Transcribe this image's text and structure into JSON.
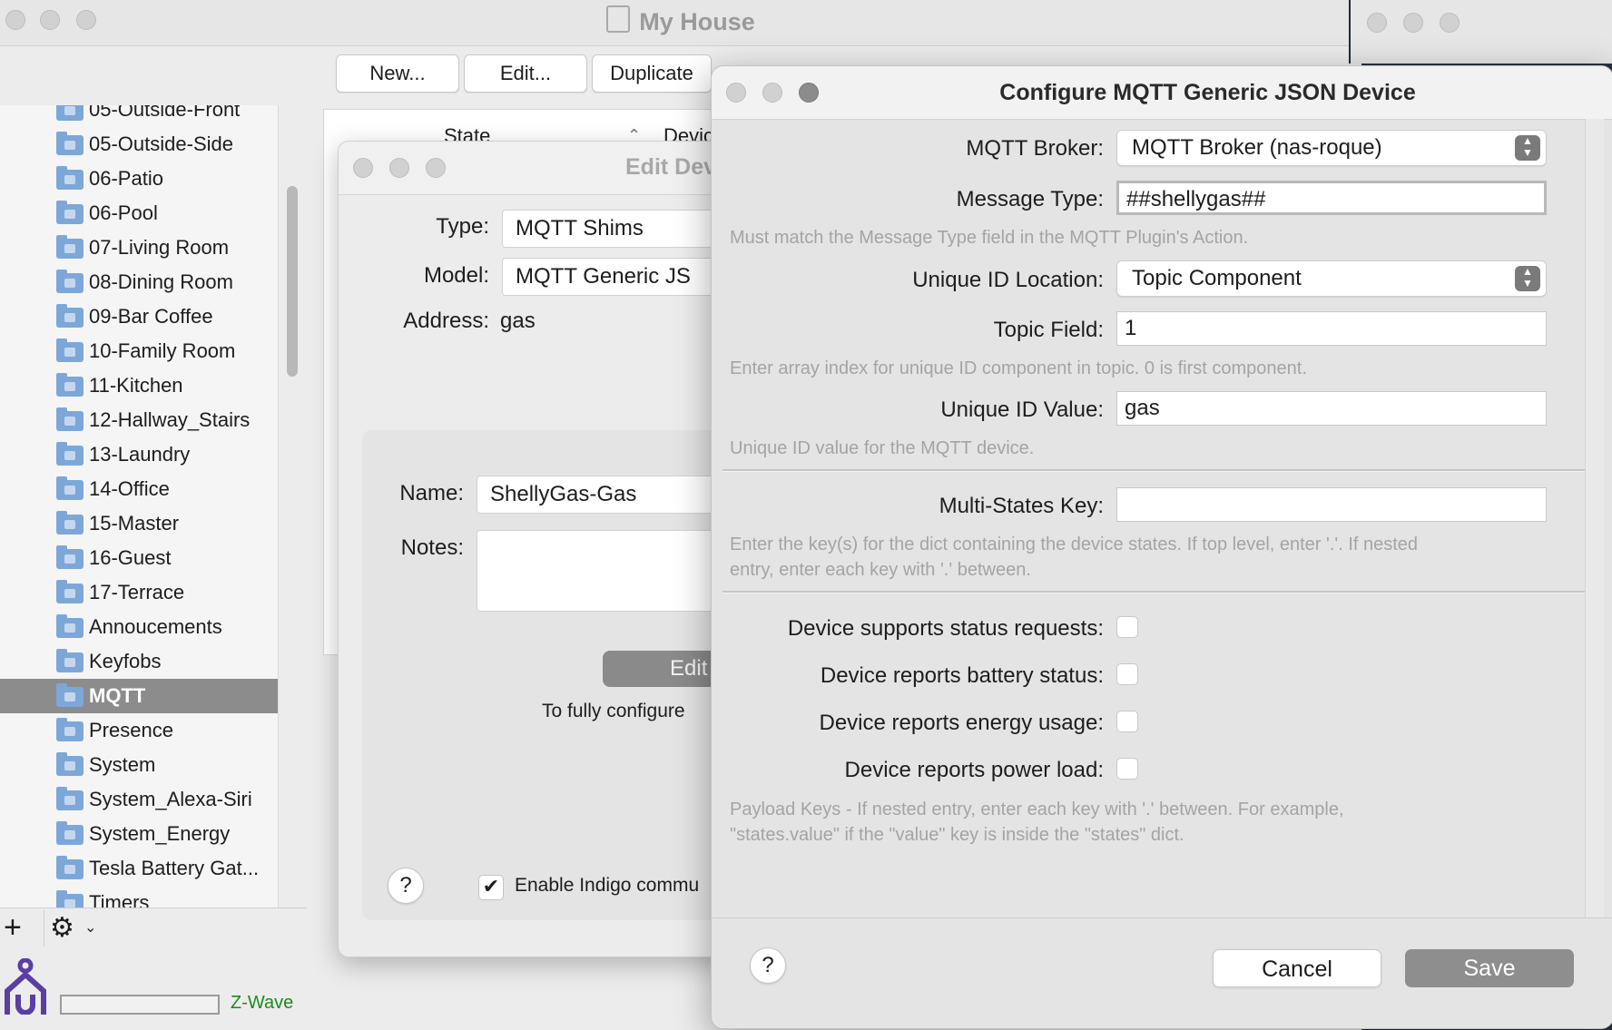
{
  "main": {
    "title": "My House",
    "toolbar": {
      "new_label": "New...",
      "edit_label": "Edit...",
      "duplicate_label": "Duplicate"
    },
    "list_header": {
      "state": "State",
      "device": "Devic"
    },
    "sidebar_items": [
      "05-Outside-Front",
      "05-Outside-Side",
      "06-Patio",
      "06-Pool",
      "07-Living Room",
      "08-Dining Room",
      "09-Bar Coffee",
      "10-Family Room",
      "11-Kitchen",
      "12-Hallway_Stairs",
      "13-Laundry",
      "14-Office",
      "15-Master",
      "16-Guest",
      "17-Terrace",
      "Annoucements",
      "Keyfobs",
      "MQTT",
      "Presence",
      "System",
      "System_Alexa-Siri",
      "System_Energy",
      "Tesla Battery Gat...",
      "Timers"
    ],
    "selected_item": "MQTT",
    "status": {
      "zwave_label": "Z-Wave"
    }
  },
  "edit_device": {
    "title": "Edit Dev",
    "type_label": "Type:",
    "type_value": "MQTT Shims",
    "model_label": "Model:",
    "model_value": "MQTT Generic JS",
    "address_label": "Address:",
    "address_value": "gas",
    "name_label": "Name:",
    "name_value": "ShellyGas-Gas",
    "notes_label": "Notes:",
    "edit_button": "Edit",
    "configure_text": "To fully configure",
    "enable_label": "Enable Indigo commu",
    "enable_checked": true,
    "help_symbol": "?"
  },
  "configure": {
    "title": "Configure MQTT Generic JSON Device",
    "broker_label": "MQTT Broker:",
    "broker_value": "MQTT Broker (nas-roque)",
    "message_type_label": "Message Type:",
    "message_type_value": "##shellygas##",
    "message_type_help": "Must match the Message Type field in the MQTT Plugin's Action.",
    "uid_location_label": "Unique ID Location:",
    "uid_location_value": "Topic Component",
    "topic_field_label": "Topic Field:",
    "topic_field_value": "1",
    "topic_field_help": "Enter array index for unique ID component in topic.  0 is first component.",
    "uid_value_label": "Unique ID Value:",
    "uid_value_value": "gas",
    "uid_value_help": "Unique ID value for the MQTT device.",
    "multi_states_label": "Multi-States Key:",
    "multi_states_value": "",
    "multi_states_help_1": "Enter the key(s) for the dict containing the device states.  If top level, enter '.'.  If nested",
    "multi_states_help_2": "entry, enter each key with '.' between.",
    "status_requests_label": "Device supports status requests:",
    "battery_label": "Device reports battery status:",
    "energy_label": "Device reports energy usage:",
    "power_label": "Device reports power load:",
    "payload_help_1": "Payload Keys - If nested entry, enter each key with '.' between.  For example,",
    "payload_help_2": "\"states.value\" if the \"value\" key is inside the \"states\" dict.",
    "cancel_label": "Cancel",
    "save_label": "Save",
    "help_symbol": "?"
  },
  "colors": {
    "zwave": "#1e8a1e",
    "selected": "#8c8c8c",
    "save": "#8e8e8e",
    "logo": "#5b3fa0"
  }
}
